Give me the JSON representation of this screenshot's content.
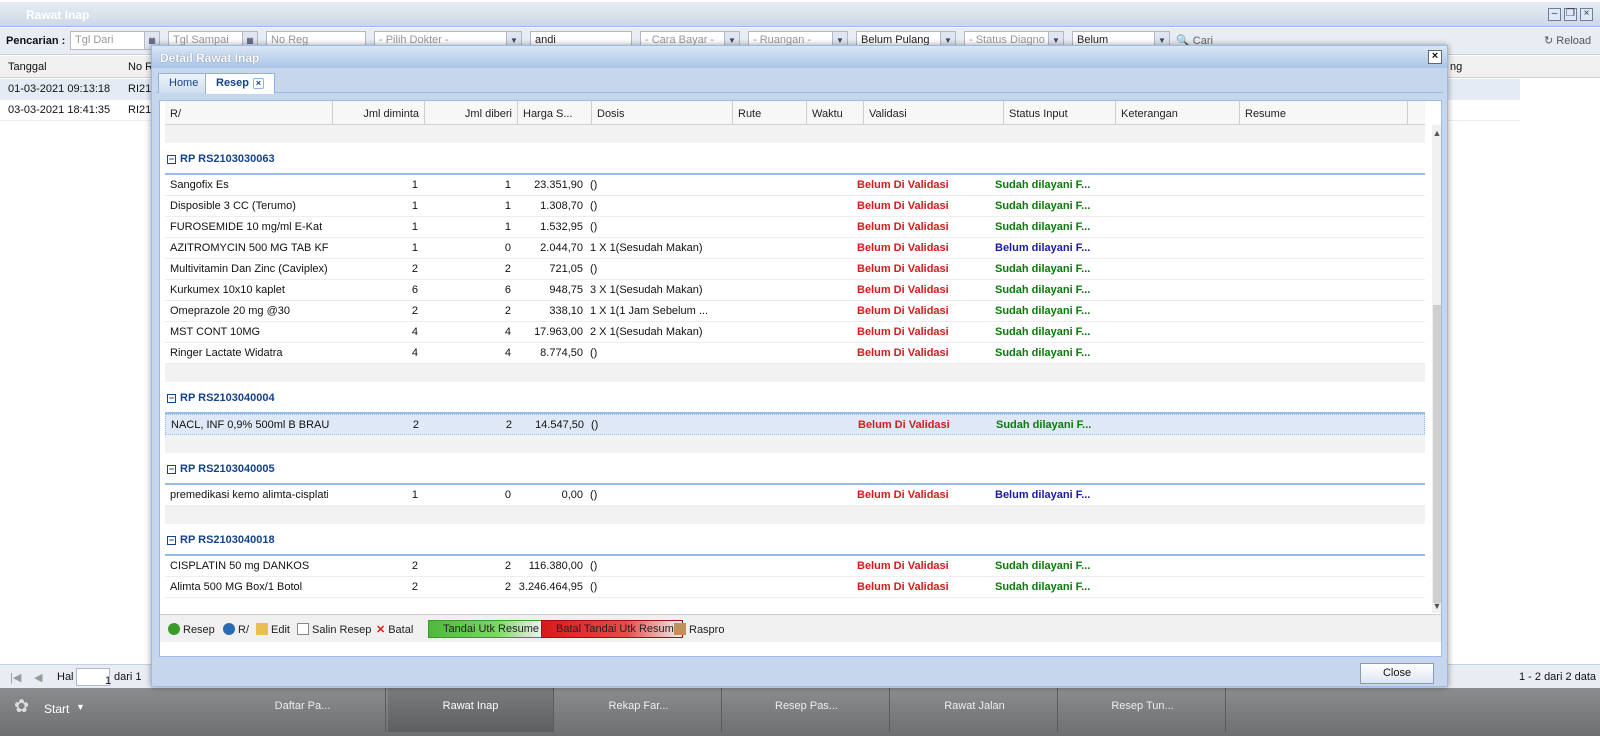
{
  "bg_window": {
    "title": "Rawat Inap",
    "search_label": "Pencarian :",
    "filters": {
      "tgl_dari_placeholder": "Tgl Dari",
      "tgl_sampai_placeholder": "Tgl Sampai",
      "no_reg_placeholder": "No Reg",
      "dokter_placeholder": "- Pilih Dokter -",
      "name_value": "andi",
      "cara_bayar_placeholder": "- Cara Bayar -",
      "ruangan_placeholder": "- Ruangan -",
      "pulang_value": "Belum Pulang",
      "status_diagnosa_placeholder": "- Status Diagno",
      "belum_value": "Belum",
      "cari_label": "Cari",
      "reload_label": "Reload"
    },
    "columns": [
      "Tanggal",
      "No Re",
      "ng"
    ],
    "rows": [
      {
        "tanggal": "01-03-2021 09:13:18",
        "no": "RI210"
      },
      {
        "tanggal": "03-03-2021 18:41:35",
        "no": "RI210"
      }
    ],
    "pager": {
      "hal_label": "Hal",
      "page": "1",
      "dari": "dari 1",
      "range": "1 - 2 dari 2 data"
    }
  },
  "taskbar": {
    "start_label": "Start",
    "items": [
      "Daftar Pa...",
      "Rawat Inap",
      "Rekap Far...",
      "Resep Pas...",
      "Rawat Jalan",
      "Resep Tun..."
    ]
  },
  "dialog": {
    "title": "Detail Rawat Inap",
    "tabs": [
      "Home",
      "Resep"
    ],
    "columns": [
      "R/",
      "Jml diminta",
      "Jml diberi",
      "Harga S...",
      "Dosis",
      "Rute",
      "Waktu",
      "Validasi",
      "Status Input",
      "Keterangan",
      "Resume"
    ],
    "groups": [
      {
        "title": "RP RS2103030063",
        "rows": [
          {
            "name": "Sangofix Es",
            "diminta": "1",
            "diberi": "1",
            "harga": "23.351,90",
            "dosis": "()",
            "validasi": "Belum Di Validasi",
            "status": "Sudah dilayani F...",
            "ok": true
          },
          {
            "name": "Disposible 3 CC (Terumo)",
            "diminta": "1",
            "diberi": "1",
            "harga": "1.308,70",
            "dosis": "()",
            "validasi": "Belum Di Validasi",
            "status": "Sudah dilayani F...",
            "ok": true
          },
          {
            "name": "FUROSEMIDE 10 mg/ml E-Kat",
            "diminta": "1",
            "diberi": "1",
            "harga": "1.532,95",
            "dosis": "()",
            "validasi": "Belum Di Validasi",
            "status": "Sudah dilayani F...",
            "ok": true
          },
          {
            "name": "AZITROMYCIN 500 MG TAB KF",
            "diminta": "1",
            "diberi": "0",
            "harga": "2.044,70",
            "dosis": "1 X 1(Sesudah Makan)",
            "validasi": "Belum Di Validasi",
            "status": "Belum dilayani F...",
            "ok": false
          },
          {
            "name": "Multivitamin Dan Zinc (Caviplex)",
            "diminta": "2",
            "diberi": "2",
            "harga": "721,05",
            "dosis": "()",
            "validasi": "Belum Di Validasi",
            "status": "Sudah dilayani F...",
            "ok": true
          },
          {
            "name": "Kurkumex 10x10 kaplet",
            "diminta": "6",
            "diberi": "6",
            "harga": "948,75",
            "dosis": "3 X 1(Sesudah Makan)",
            "validasi": "Belum Di Validasi",
            "status": "Sudah dilayani F...",
            "ok": true
          },
          {
            "name": "Omeprazole 20 mg @30",
            "diminta": "2",
            "diberi": "2",
            "harga": "338,10",
            "dosis": "1 X 1(1 Jam Sebelum ...",
            "validasi": "Belum Di Validasi",
            "status": "Sudah dilayani F...",
            "ok": true
          },
          {
            "name": "MST CONT 10MG",
            "diminta": "4",
            "diberi": "4",
            "harga": "17.963,00",
            "dosis": "2 X 1(Sesudah Makan)",
            "validasi": "Belum Di Validasi",
            "status": "Sudah dilayani F...",
            "ok": true
          },
          {
            "name": "Ringer Lactate Widatra",
            "diminta": "4",
            "diberi": "4",
            "harga": "8.774,50",
            "dosis": "()",
            "validasi": "Belum Di Validasi",
            "status": "Sudah dilayani F...",
            "ok": true
          }
        ]
      },
      {
        "title": "RP RS2103040004",
        "rows": [
          {
            "name": "NACL, INF 0,9% 500ml B BRAUN",
            "diminta": "2",
            "diberi": "2",
            "harga": "14.547,50",
            "dosis": "()",
            "validasi": "Belum Di Validasi",
            "status": "Sudah dilayani F...",
            "ok": true,
            "selected": true
          }
        ]
      },
      {
        "title": "RP RS2103040005",
        "rows": [
          {
            "name": "premedikasi kemo alimta-cisplatin",
            "diminta": "1",
            "diberi": "0",
            "harga": "0,00",
            "dosis": "()",
            "validasi": "Belum Di Validasi",
            "status": "Belum dilayani F...",
            "ok": false
          }
        ]
      },
      {
        "title": "RP RS2103040018",
        "rows": [
          {
            "name": "CISPLATIN 50 mg DANKOS",
            "diminta": "2",
            "diberi": "2",
            "harga": "116.380,00",
            "dosis": "()",
            "validasi": "Belum Di Validasi",
            "status": "Sudah dilayani F...",
            "ok": true
          },
          {
            "name": "Alimta 500 MG Box/1 Botol",
            "diminta": "2",
            "diberi": "2",
            "harga": "3.246.464,95",
            "dosis": "()",
            "validasi": "Belum Di Validasi",
            "status": "Sudah dilayani F...",
            "ok": true
          }
        ]
      }
    ],
    "toolbar": {
      "resep": "Resep",
      "r": "R/",
      "edit": "Edit",
      "salin": "Salin Resep",
      "batal": "Batal",
      "tandai": "Tandai Utk Resume",
      "batal_tandai": "Batal Tandai Utk Resume",
      "raspro": "Raspro"
    },
    "close_label": "Close"
  },
  "colors": {
    "ok": "#0a7a0a",
    "not_ok": "#1a1aa8",
    "validasi": "#d81a1a",
    "group": "#15428b"
  }
}
